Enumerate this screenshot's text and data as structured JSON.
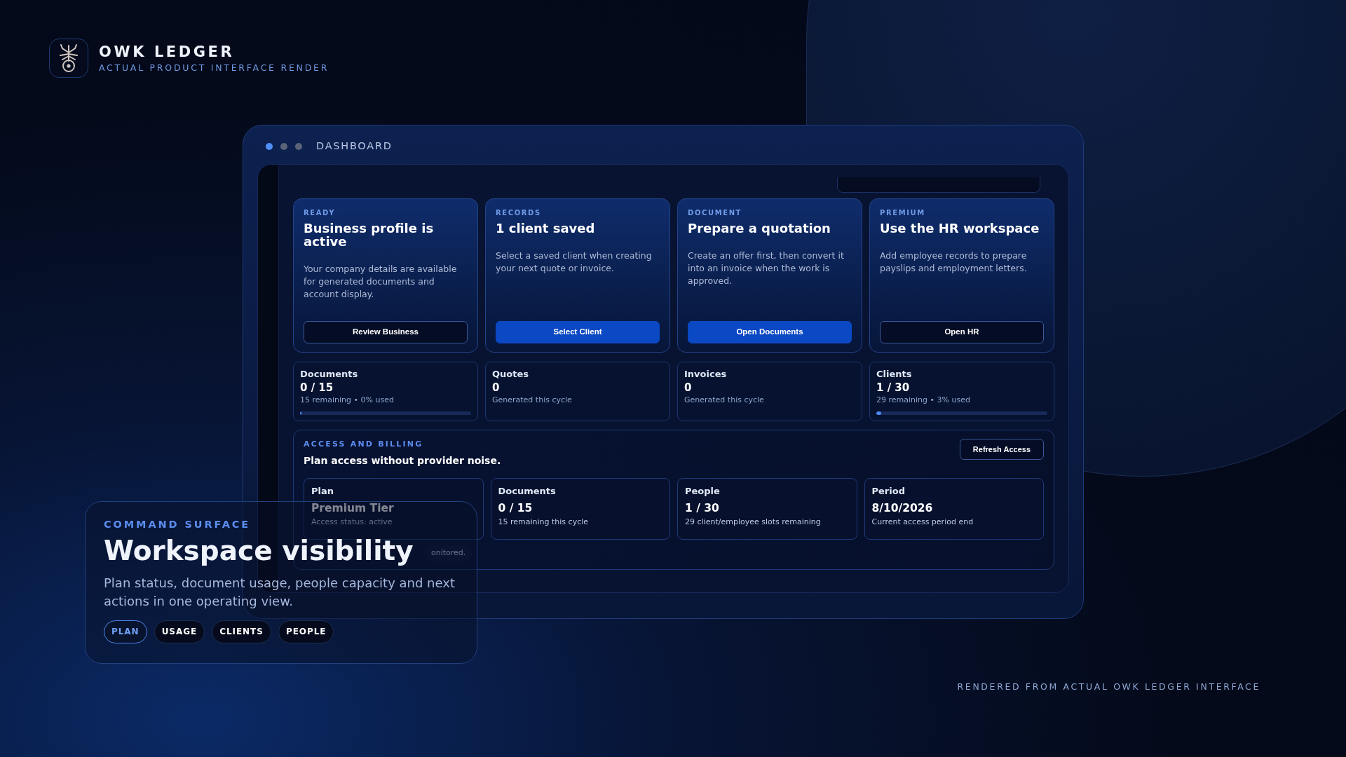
{
  "brand": {
    "name": "OWK LEDGER",
    "tagline": "ACTUAL PRODUCT INTERFACE RENDER"
  },
  "window": {
    "title": "DASHBOARD"
  },
  "action_cards": [
    {
      "eyebrow": "READY",
      "title": "Business profile is active",
      "body": "Your company details are available for generated documents and account display.",
      "button": {
        "label": "Review Business",
        "kind": "outline"
      }
    },
    {
      "eyebrow": "RECORDS",
      "title": "1 client saved",
      "body": "Select a saved client when creating your next quote or invoice.",
      "button": {
        "label": "Select Client",
        "kind": "primary"
      }
    },
    {
      "eyebrow": "DOCUMENT",
      "title": "Prepare a quotation",
      "body": "Create an offer first, then convert it into an invoice when the work is approved.",
      "button": {
        "label": "Open Documents",
        "kind": "primary"
      }
    },
    {
      "eyebrow": "PREMIUM",
      "title": "Use the HR workspace",
      "body": "Add employee records to prepare payslips and employment letters.",
      "button": {
        "label": "Open HR",
        "kind": "outline"
      }
    }
  ],
  "stats": [
    {
      "label": "Documents",
      "value": "0 / 15",
      "note": "15 remaining • 0% used",
      "level": 0
    },
    {
      "label": "Quotes",
      "value": "0",
      "note": "Generated this cycle"
    },
    {
      "label": "Invoices",
      "value": "0",
      "note": "Generated this cycle"
    },
    {
      "label": "Clients",
      "value": "1 / 30",
      "note": "29 remaining • 3% used",
      "level": 0.03
    }
  ],
  "access": {
    "eyebrow": "ACCESS AND BILLING",
    "heading": "Plan access without provider noise.",
    "button": "Refresh Access",
    "tiles": [
      {
        "label": "Plan",
        "value": "Premium Tier",
        "note": "Access status: active"
      },
      {
        "label": "Documents",
        "value": "0 / 15",
        "note": "15 remaining this cycle"
      },
      {
        "label": "People",
        "value": "1 / 30",
        "note": "29 client/employee slots remaining"
      },
      {
        "label": "Period",
        "value": "8/10/2026",
        "note": "Current access period end"
      }
    ],
    "status_pill": "onitored."
  },
  "feature": {
    "eyebrow": "COMMAND SURFACE",
    "title": "Workspace visibility",
    "body": "Plan status, document usage, people capacity and next actions in one operating view.",
    "tags": [
      {
        "label": "PLAN",
        "selected": true
      },
      {
        "label": "USAGE",
        "selected": false
      },
      {
        "label": "CLIENTS",
        "selected": false
      },
      {
        "label": "PEOPLE",
        "selected": false
      }
    ]
  },
  "footer": "RENDERED FROM ACTUAL OWK LEDGER INTERFACE"
}
